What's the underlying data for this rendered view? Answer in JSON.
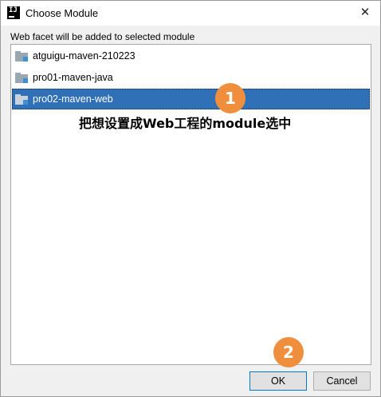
{
  "window": {
    "title": "Choose Module",
    "logo_text": "IJ",
    "close_glyph": "✕"
  },
  "instruction": "Web facet will be added to selected module",
  "modules": [
    {
      "label": "atguigu-maven-210223",
      "icon": "module-folder-icon",
      "selected": false
    },
    {
      "label": "pro01-maven-java",
      "icon": "module-folder-icon",
      "selected": false
    },
    {
      "label": "pro02-maven-web",
      "icon": "module-folder-icon",
      "selected": true
    }
  ],
  "annotations": {
    "step1_number": "1",
    "step1_text": "把想设置成Web工程的module选中",
    "step2_number": "2",
    "badge_color": "#ef8e3c"
  },
  "buttons": {
    "ok_label": "OK",
    "cancel_label": "Cancel"
  },
  "colors": {
    "selection": "#2f70b6",
    "focus_border": "#0078d7"
  }
}
